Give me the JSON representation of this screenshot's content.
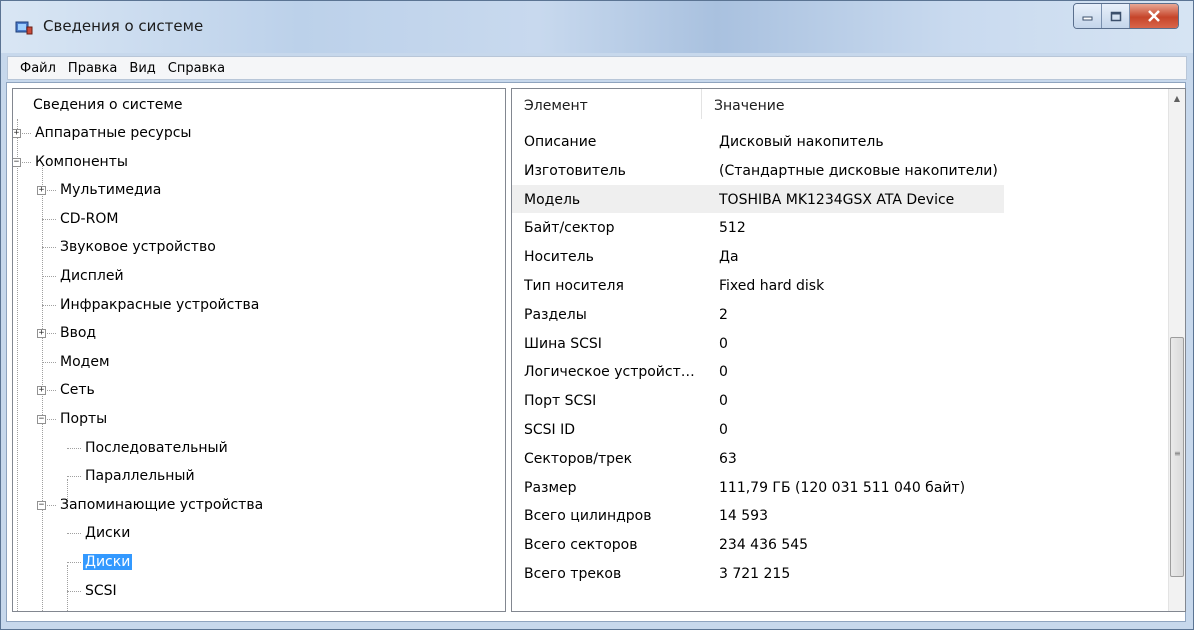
{
  "window": {
    "title": "Сведения о системе",
    "icon": "system-info-icon",
    "controls": [
      "minimize-icon",
      "maximize-icon",
      "close-icon"
    ]
  },
  "menu": [
    "Файл",
    "Правка",
    "Вид",
    "Справка"
  ],
  "tree": {
    "root": "Сведения о системе",
    "items": [
      {
        "label": "Аппаратные ресурсы",
        "level": 1,
        "expander": "+"
      },
      {
        "label": "Компоненты",
        "level": 1,
        "expander": "-"
      },
      {
        "label": "Мультимедиа",
        "level": 2,
        "expander": "+"
      },
      {
        "label": "CD-ROM",
        "level": 2
      },
      {
        "label": "Звуковое устройство",
        "level": 2
      },
      {
        "label": "Дисплей",
        "level": 2
      },
      {
        "label": "Инфракрасные устройства",
        "level": 2
      },
      {
        "label": "Ввод",
        "level": 2,
        "expander": "+"
      },
      {
        "label": "Модем",
        "level": 2
      },
      {
        "label": "Сеть",
        "level": 2,
        "expander": "+"
      },
      {
        "label": "Порты",
        "level": 2,
        "expander": "-"
      },
      {
        "label": "Последовательный",
        "level": 3
      },
      {
        "label": "Параллельный",
        "level": 3
      },
      {
        "label": "Запоминающие устройства",
        "level": 2,
        "expander": "-"
      },
      {
        "label": "Диски",
        "level": 3
      },
      {
        "label": "Диски",
        "level": 3,
        "selected": true
      },
      {
        "label": "SCSI",
        "level": 3
      }
    ]
  },
  "details": {
    "columns": [
      "Элемент",
      "Значение"
    ],
    "rows": [
      {
        "item": "Описание",
        "value": "Дисковый накопитель"
      },
      {
        "item": "Изготовитель",
        "value": "(Стандартные дисковые накопители)"
      },
      {
        "item": "Модель",
        "value": "TOSHIBA MK1234GSX ATA Device",
        "highlighted": true
      },
      {
        "item": "Байт/сектор",
        "value": "512"
      },
      {
        "item": "Носитель",
        "value": "Да"
      },
      {
        "item": "Тип носителя",
        "value": "Fixed hard disk"
      },
      {
        "item": "Разделы",
        "value": "2"
      },
      {
        "item": "Шина SCSI",
        "value": "0"
      },
      {
        "item": "Логическое устройств...",
        "value": "0"
      },
      {
        "item": "Порт SCSI",
        "value": "0"
      },
      {
        "item": "SCSI ID",
        "value": "0"
      },
      {
        "item": "Секторов/трек",
        "value": "63"
      },
      {
        "item": "Размер",
        "value": "111,79 ГБ (120 031 511 040 байт)"
      },
      {
        "item": "Всего цилиндров",
        "value": "14 593"
      },
      {
        "item": "Всего секторов",
        "value": "234 436 545"
      },
      {
        "item": "Всего треков",
        "value": "3 721 215"
      }
    ]
  }
}
